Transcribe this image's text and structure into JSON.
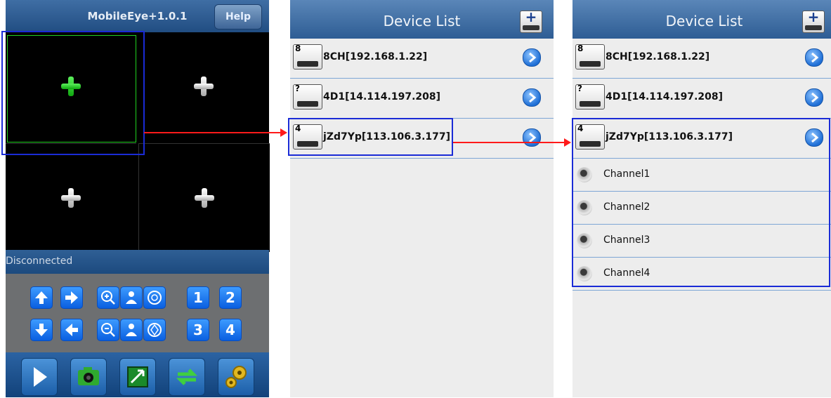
{
  "screen1": {
    "app_title": "MobileEye+1.0.1",
    "help_label": "Help",
    "status": "Disconnected",
    "controls": {
      "channel_1": "1",
      "channel_2": "2",
      "channel_3": "3",
      "channel_4": "4"
    },
    "icons": [
      "up-arrow-icon",
      "right-arrow-icon",
      "zoom-in-icon",
      "focus-near-icon",
      "iris-open-icon",
      "down-arrow-icon",
      "left-arrow-icon",
      "zoom-out-icon",
      "focus-far-icon",
      "iris-close-icon",
      "play-icon",
      "camera-icon",
      "image-icon",
      "switch-icon",
      "settings-icon"
    ]
  },
  "screen2": {
    "title": "Device List",
    "devices": [
      {
        "badge": "8",
        "name": "8CH[192.168.1.22]"
      },
      {
        "badge": "?",
        "name": "4D1[14.114.197.208]"
      },
      {
        "badge": "4",
        "name": "jZd7Yp[113.106.3.177]"
      }
    ]
  },
  "screen3": {
    "title": "Device List",
    "devices": [
      {
        "badge": "8",
        "name": "8CH[192.168.1.22]"
      },
      {
        "badge": "?",
        "name": "4D1[14.114.197.208]"
      },
      {
        "badge": "4",
        "name": "jZd7Yp[113.106.3.177]"
      }
    ],
    "channels": [
      "Channel1",
      "Channel2",
      "Channel3",
      "Channel4"
    ]
  },
  "colors": {
    "header_blue": "#2e5d94",
    "highlight": "#1a2bd6",
    "connector": "#ff1a1a",
    "selected_plus": "#1fd11f"
  }
}
